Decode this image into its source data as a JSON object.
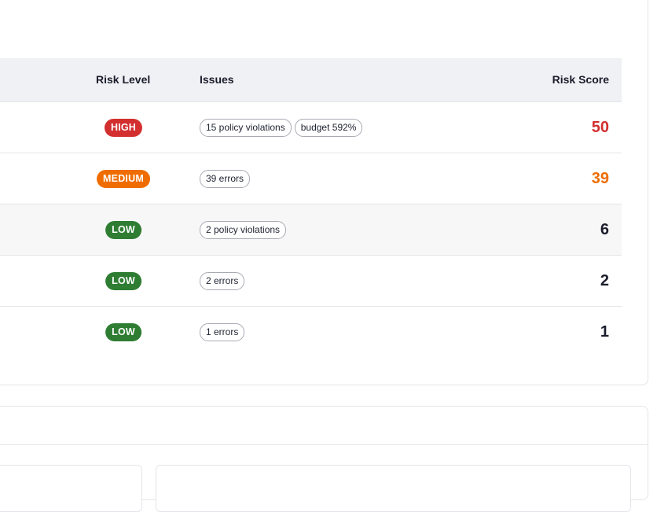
{
  "table": {
    "headers": {
      "risk_level": "Risk Level",
      "issues": "Issues",
      "risk_score": "Risk Score"
    },
    "rows": [
      {
        "level": "HIGH",
        "level_class": "high",
        "issues": [
          "15 policy violations",
          "budget 592%"
        ],
        "score": "50"
      },
      {
        "level": "MEDIUM",
        "level_class": "medium",
        "issues": [
          "39 errors"
        ],
        "score": "39"
      },
      {
        "level": "LOW",
        "level_class": "low",
        "issues": [
          "2 policy violations"
        ],
        "score": "6"
      },
      {
        "level": "LOW",
        "level_class": "low",
        "issues": [
          "2 errors"
        ],
        "score": "2"
      },
      {
        "level": "LOW",
        "level_class": "low",
        "issues": [
          "1 errors"
        ],
        "score": "1"
      }
    ]
  },
  "colors": {
    "high": "#d32f2f",
    "medium": "#ef6c00",
    "low": "#2e7d32",
    "header_bg": "#f0f1f4",
    "highlight_row": "#f7f7f8"
  }
}
